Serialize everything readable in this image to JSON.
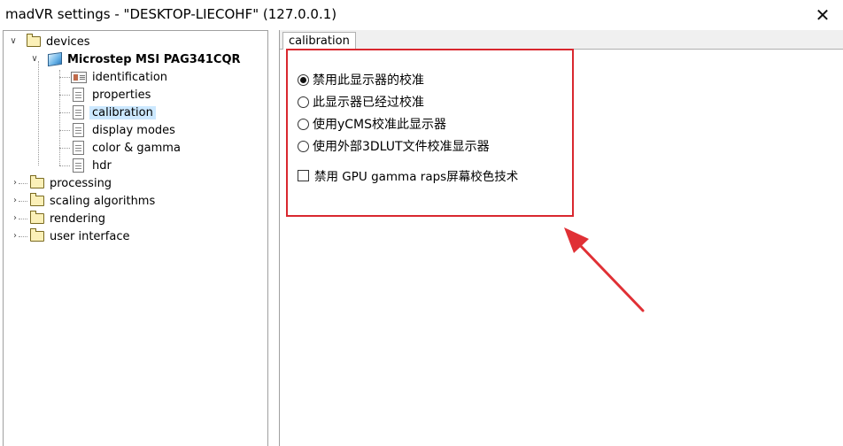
{
  "window": {
    "title": "madVR settings - \"DESKTOP-LIECOHF\" (127.0.0.1)",
    "close_glyph": "✕"
  },
  "tree": {
    "devices": "devices",
    "monitor": "Microstep MSI PAG341CQR",
    "children": [
      "identification",
      "properties",
      "calibration",
      "display modes",
      "color & gamma",
      "hdr"
    ],
    "selected": "calibration",
    "processing": "processing",
    "scaling": "scaling algorithms",
    "rendering": "rendering",
    "ui": "user interface",
    "expanded_glyph": "∨",
    "collapsed_glyph": "›"
  },
  "panel": {
    "tab": "calibration",
    "options": [
      {
        "label": "禁用此显示器的校准",
        "selected": true
      },
      {
        "label": "此显示器已经过校准",
        "selected": false
      },
      {
        "label": "使用yCMS校准此显示器",
        "selected": false
      },
      {
        "label": "使用外部3DLUT文件校准显示器",
        "selected": false
      }
    ],
    "checkbox_label": "禁用 GPU gamma raps屏幕校色技术",
    "checkbox_checked": false
  },
  "colors": {
    "highlight": "#d9282f",
    "selection": "#cce8ff"
  }
}
